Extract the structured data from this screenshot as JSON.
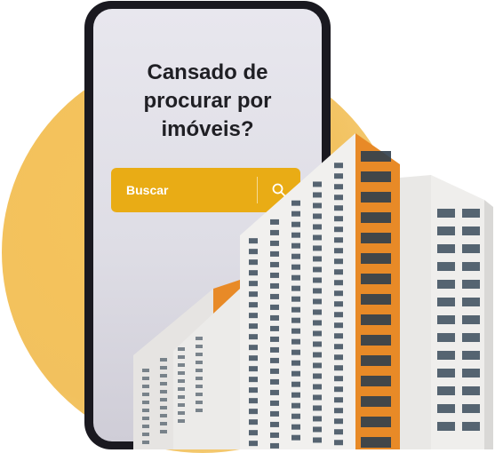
{
  "hero": {
    "headline_line1": "Cansado de",
    "headline_line2": "procurar por",
    "headline_line3": "imóveis?"
  },
  "search": {
    "label": "Buscar",
    "icon": "search-icon"
  },
  "colors": {
    "accent": "#e9ac15",
    "circle": "#f2c15e",
    "phone_frame": "#1a1920",
    "building_orange": "#e88a27"
  }
}
